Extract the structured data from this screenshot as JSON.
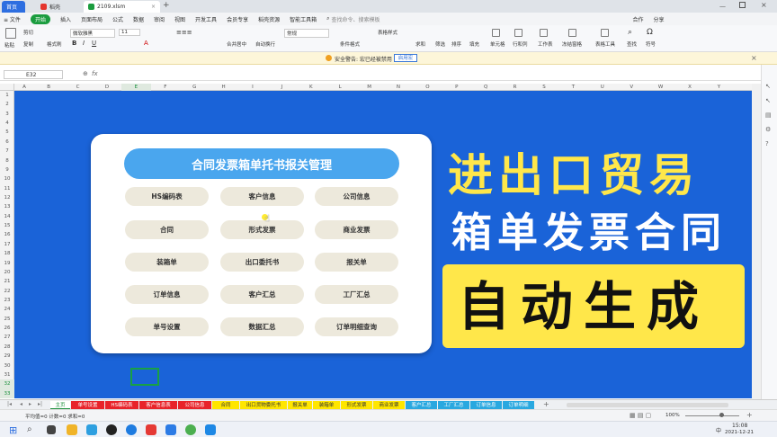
{
  "titlebar": {
    "tabs": [
      {
        "label": "首页",
        "active": false
      },
      {
        "label": "稻壳",
        "active": false
      },
      {
        "label": "2109.xlsm",
        "active": true
      }
    ],
    "new_tab": "+"
  },
  "menu": {
    "items": [
      "≡ 文件",
      "开始",
      "插入",
      "页面布局",
      "公式",
      "数据",
      "审阅",
      "视图",
      "开发工具",
      "会员专享",
      "稻壳资源",
      "智能工具箱"
    ],
    "search_placeholder": "查找命令、搜索模板",
    "right": [
      "合作",
      "分享"
    ]
  },
  "ribbon": {
    "labels": [
      "粘贴",
      "剪切",
      "复制",
      "格式刷",
      "微软雅黑",
      "11",
      "合并居中",
      "自动换行",
      "常规",
      "条件格式",
      "表格样式",
      "求和",
      "筛选",
      "排序",
      "填充",
      "单元格",
      "行和列",
      "工作表",
      "冻结窗格",
      "表格工具",
      "查找",
      "符号"
    ]
  },
  "security": {
    "text": "安全警告: 宏已经被禁用",
    "button": "启用宏"
  },
  "formula": {
    "cell_ref": "E32",
    "fx": "fx",
    "value": ""
  },
  "columns": [
    "A",
    "B",
    "C",
    "D",
    "E",
    "F",
    "G",
    "H",
    "I",
    "J",
    "K",
    "L",
    "M",
    "N",
    "O",
    "P",
    "Q",
    "R",
    "S",
    "T",
    "U",
    "V",
    "W",
    "X",
    "Y"
  ],
  "rows": [
    "1",
    "2",
    "3",
    "4",
    "5",
    "6",
    "7",
    "8",
    "9",
    "10",
    "11",
    "12",
    "13",
    "14",
    "15",
    "16",
    "17",
    "18",
    "19",
    "20",
    "21",
    "22",
    "23",
    "24",
    "25",
    "26",
    "27",
    "28",
    "29",
    "30",
    "31",
    "32",
    "33"
  ],
  "panel": {
    "title": "合同发票箱单托书报关管理",
    "buttons": [
      "HS编码表",
      "客户信息",
      "公司信息",
      "合同",
      "形式发票",
      "商业发票",
      "装箱单",
      "出口委托书",
      "报关单",
      "订单信息",
      "客户汇总",
      "工厂汇总",
      "单号设置",
      "数据汇总",
      "订单明细查询"
    ]
  },
  "banner": {
    "line1": "进出口贸易",
    "line2": "箱单发票合同",
    "line3": "自动生成",
    "colors": {
      "yellow": "#ffe74a",
      "white": "#ffffff",
      "black": "#111111"
    }
  },
  "sheet_tabs": [
    {
      "label": "主页",
      "color": "#ffffff",
      "text": "#1a8f3c"
    },
    {
      "label": "单号设置",
      "color": "#e8232a",
      "text": "#ffffff"
    },
    {
      "label": "HS编码表",
      "color": "#e8232a",
      "text": "#ffffff"
    },
    {
      "label": "客户信息表",
      "color": "#e8232a",
      "text": "#ffffff"
    },
    {
      "label": "公司信息",
      "color": "#e8232a",
      "text": "#ffffff"
    },
    {
      "label": "合同",
      "color": "#ffe600",
      "text": "#333333"
    },
    {
      "label": "出口货物委托书",
      "color": "#ffe600",
      "text": "#333333"
    },
    {
      "label": "报关单",
      "color": "#ffe600",
      "text": "#333333"
    },
    {
      "label": "装箱单",
      "color": "#ffe600",
      "text": "#333333"
    },
    {
      "label": "形式发票",
      "color": "#ffe600",
      "text": "#333333"
    },
    {
      "label": "商业发票",
      "color": "#ffe600",
      "text": "#333333"
    },
    {
      "label": "客户汇总",
      "color": "#29a8e0",
      "text": "#ffffff"
    },
    {
      "label": "工厂汇总",
      "color": "#29a8e0",
      "text": "#ffffff"
    },
    {
      "label": "订单信息",
      "color": "#29a8e0",
      "text": "#ffffff"
    },
    {
      "label": "订单明细",
      "color": "#29a8e0",
      "text": "#ffffff"
    }
  ],
  "status": {
    "left": "平均值=0  计数=0  求和=0",
    "zoom": "100%"
  },
  "taskbar": {
    "time": "15:08",
    "date": "2021-12-21",
    "lang": "中"
  }
}
